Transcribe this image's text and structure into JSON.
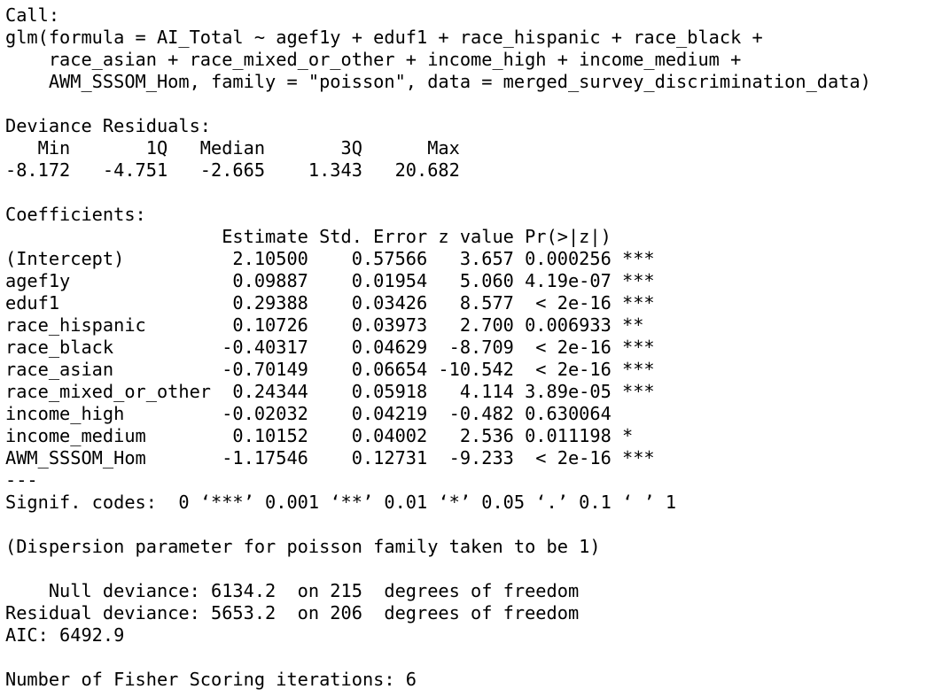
{
  "console": {
    "lines": [
      "Call:",
      "glm(formula = AI_Total ~ agef1y + eduf1 + race_hispanic + race_black + ",
      "    race_asian + race_mixed_or_other + income_high + income_medium + ",
      "    AWM_SSSOM_Hom, family = \"poisson\", data = merged_survey_discrimination_data)",
      "",
      "Deviance Residuals: ",
      "   Min       1Q   Median       3Q      Max  ",
      "-8.172   -4.751   -2.665    1.343   20.682  ",
      "",
      "Coefficients:",
      "                    Estimate Std. Error z value Pr(>|z|)    ",
      "(Intercept)          2.10500    0.57566   3.657 0.000256 ***",
      "agef1y               0.09887    0.01954   5.060 4.19e-07 ***",
      "eduf1                0.29388    0.03426   8.577  < 2e-16 ***",
      "race_hispanic        0.10726    0.03973   2.700 0.006933 ** ",
      "race_black          -0.40317    0.04629  -8.709  < 2e-16 ***",
      "race_asian          -0.70149    0.06654 -10.542  < 2e-16 ***",
      "race_mixed_or_other  0.24344    0.05918   4.114 3.89e-05 ***",
      "income_high         -0.02032    0.04219  -0.482 0.630064    ",
      "income_medium        0.10152    0.04002   2.536 0.011198 *  ",
      "AWM_SSSOM_Hom       -1.17546    0.12731  -9.233  < 2e-16 ***",
      "---",
      "Signif. codes:  0 ‘***’ 0.001 ‘**’ 0.01 ‘*’ 0.05 ‘.’ 0.1 ‘ ’ 1",
      "",
      "(Dispersion parameter for poisson family taken to be 1)",
      "",
      "    Null deviance: 6134.2  on 215  degrees of freedom",
      "Residual deviance: 5653.2  on 206  degrees of freedom",
      "AIC: 6492.9",
      "",
      "Number of Fisher Scoring iterations: 6"
    ]
  }
}
